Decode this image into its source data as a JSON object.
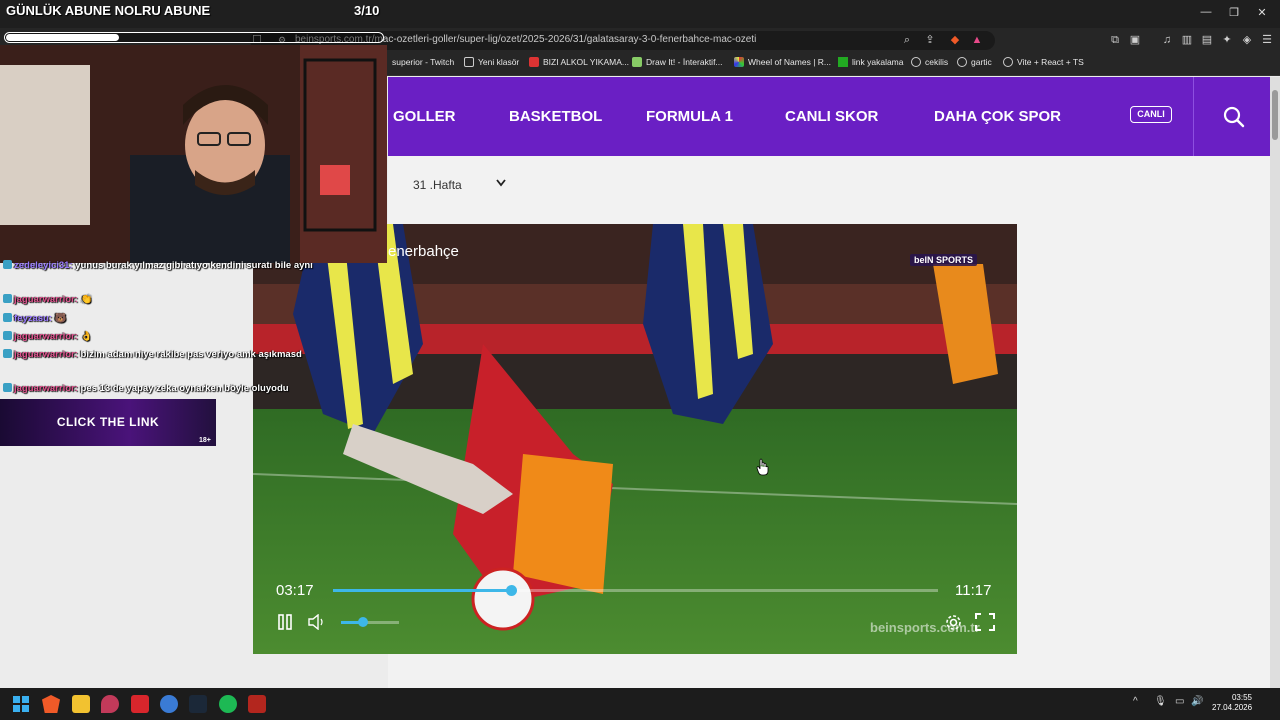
{
  "overlay": {
    "title": "GÜNLÜK ABUNE NOLRU ABUNE",
    "counter": "3/10",
    "progress": 0.3,
    "click_link": "CLICK THE LINK",
    "age_tag": "18+"
  },
  "chat": [
    {
      "user": "zedeleyici31:",
      "message": " yunus burak yılmaz gibi atıyo kendini suratı bile aynı"
    },
    {
      "user": "jaguarwarrior:",
      "message": " 👏"
    },
    {
      "user": "feyzasu:",
      "message": " 🐻"
    },
    {
      "user": "jaguarwarrior:",
      "message": " 👌"
    },
    {
      "user": "jaguarwarrior:",
      "message": " bizim adam niye rakibe pas veriyo amk aşıkmasd"
    },
    {
      "user": "jaguarwarrior:",
      "message": " pes 13 de yapay zeka oynarken böyle oluyodu"
    }
  ],
  "browser": {
    "url": "beinsports.com.tr/mac-ozetleri-goller/super-lig/ozet/2025-2026/31/galatasaray-3-0-fenerbahce-mac-ozeti",
    "bookmarks": [
      "superior - Twitch",
      "Yeni klasör",
      "BIZI ALKOL YIKAMA...",
      "Draw It! - İnteraktif...",
      "Wheel of Names | R...",
      "link yakalama",
      "cekilis",
      "gartic",
      "Vite + React + TS"
    ]
  },
  "site": {
    "nav": [
      "GOLLER",
      "BASKETBOL",
      "FORMULA 1",
      "CANLI SKOR",
      "DAHA ÇOK SPOR"
    ],
    "live_label": "CANLI",
    "week_label": "31 .Hafta"
  },
  "player": {
    "current_time": "03:17",
    "total_time": "11:17",
    "progress": 0.294,
    "volume": 0.38,
    "team_title": "enerbahçe",
    "channel_logo": "beIN SPORTS",
    "watermark": "beinsports.com.tr"
  },
  "taskbar": {
    "time": "03:55",
    "date": "27.04.2026"
  },
  "colors": {
    "nav_purple": "#6a1fc4",
    "progress_blue": "#3db7e8"
  }
}
